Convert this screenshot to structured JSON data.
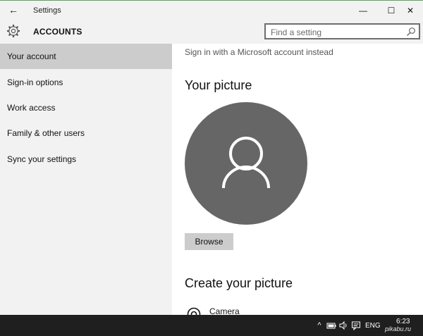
{
  "window": {
    "title": "Settings",
    "back_icon": "←",
    "minimize_icon": "—",
    "maximize_icon": "☐",
    "close_icon": "✕"
  },
  "header": {
    "section_title": "ACCOUNTS",
    "search_placeholder": "Find a setting"
  },
  "sidebar": {
    "items": [
      {
        "label": "Your account",
        "active": true
      },
      {
        "label": "Sign-in options",
        "active": false
      },
      {
        "label": "Work access",
        "active": false
      },
      {
        "label": "Family & other users",
        "active": false
      },
      {
        "label": "Sync your settings",
        "active": false
      }
    ]
  },
  "content": {
    "signin_link": "Sign in with a Microsoft account instead",
    "your_picture_heading": "Your picture",
    "browse_label": "Browse",
    "create_picture_heading": "Create your picture",
    "camera_label": "Camera"
  },
  "taskbar": {
    "language": "ENG",
    "time": "6:23",
    "watermark": "pikabu.ru"
  },
  "colors": {
    "chrome_bg": "#f2f2f2",
    "active_nav_bg": "#cccccc",
    "avatar_bg": "#666666",
    "taskbar_bg": "#1f1f1f",
    "accent_top_border": "#4caf50"
  }
}
